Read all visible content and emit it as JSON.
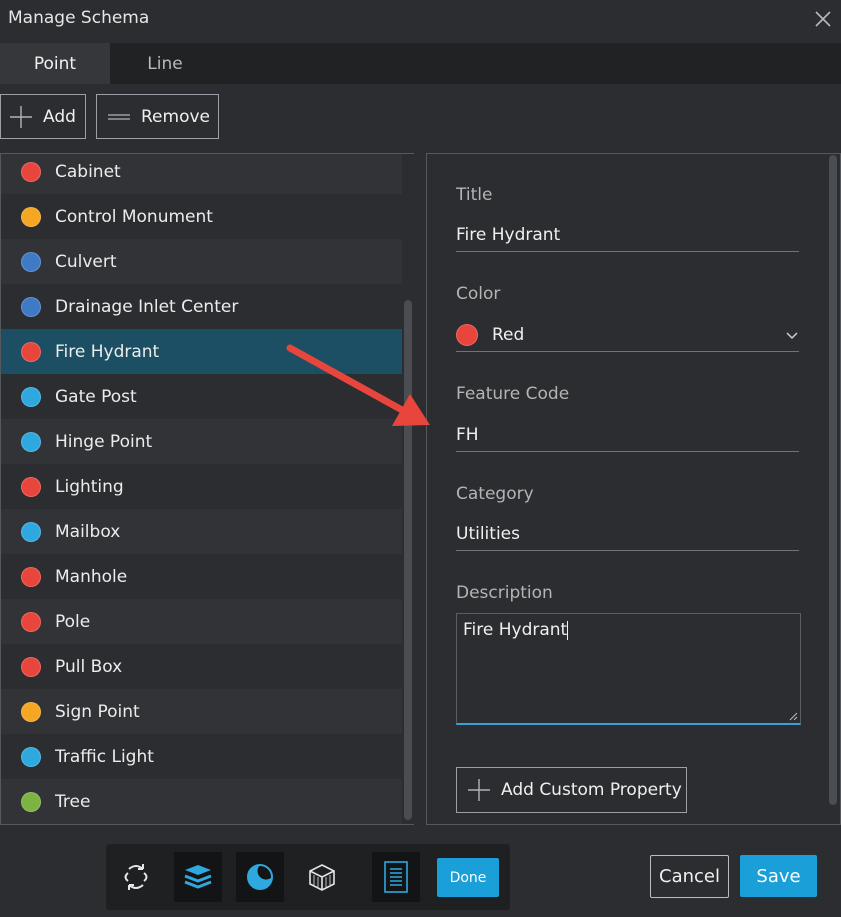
{
  "window": {
    "title": "Manage Schema"
  },
  "tabs": [
    {
      "label": "Point",
      "active": true
    },
    {
      "label": "Line",
      "active": false
    }
  ],
  "toolbar": {
    "add_label": "Add",
    "remove_label": "Remove"
  },
  "features": [
    {
      "label": "Cabinet",
      "color": "#e8453c"
    },
    {
      "label": "Control Monument",
      "color": "#f5a623"
    },
    {
      "label": "Culvert",
      "color": "#3f7ac7"
    },
    {
      "label": "Drainage Inlet Center",
      "color": "#3f7ac7"
    },
    {
      "label": "Fire Hydrant",
      "color": "#e8453c",
      "selected": true
    },
    {
      "label": "Gate Post",
      "color": "#2fa8e0"
    },
    {
      "label": "Hinge Point",
      "color": "#2fa8e0"
    },
    {
      "label": "Lighting",
      "color": "#e8453c"
    },
    {
      "label": "Mailbox",
      "color": "#2fa8e0"
    },
    {
      "label": "Manhole",
      "color": "#e8453c"
    },
    {
      "label": "Pole",
      "color": "#e8453c"
    },
    {
      "label": "Pull Box",
      "color": "#e8453c"
    },
    {
      "label": "Sign Point",
      "color": "#f5a623"
    },
    {
      "label": "Traffic Light",
      "color": "#2fa8e0"
    },
    {
      "label": "Tree",
      "color": "#7cb342"
    }
  ],
  "details": {
    "title_label": "Title",
    "title_value": "Fire Hydrant",
    "color_label": "Color",
    "color_value": "Red",
    "color_hex": "#e8453c",
    "feature_code_label": "Feature Code",
    "feature_code_value": "FH",
    "category_label": "Category",
    "category_value": "Utilities",
    "description_label": "Description",
    "description_value": "Fire Hydrant",
    "add_custom_property_label": "Add Custom Property"
  },
  "footer": {
    "icons": [
      "rotate-icon",
      "layers-icon",
      "shading-icon",
      "cube-icon",
      "document-icon"
    ],
    "done_label": "Done",
    "cancel_label": "Cancel",
    "save_label": "Save"
  },
  "colors": {
    "accent": "#1a9fd9",
    "selection": "#1d4f64",
    "annotation_arrow": "#e8453c"
  }
}
